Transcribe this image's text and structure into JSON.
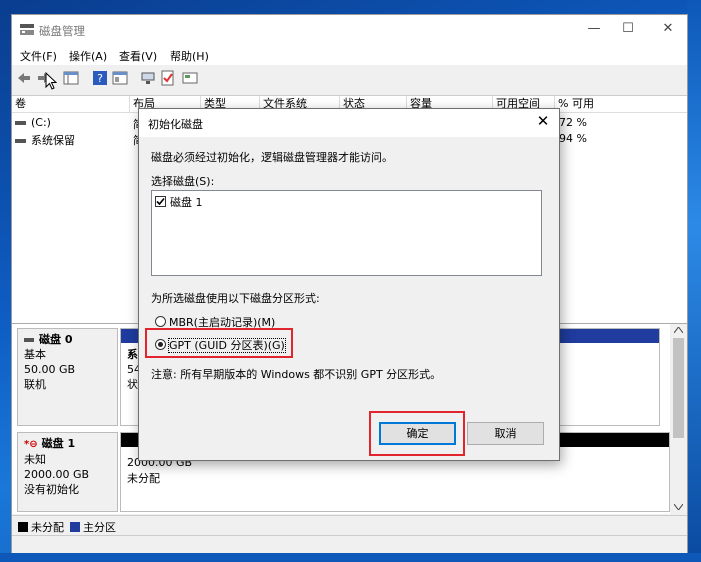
{
  "window": {
    "title": "磁盘管理",
    "controls": {
      "minimize": "—",
      "maximize": "☐",
      "close": "✕"
    }
  },
  "menubar": {
    "items": [
      "文件(F)",
      "操作(A)",
      "查看(V)",
      "帮助(H)"
    ]
  },
  "toolbar": {
    "icons": [
      "back-arrow-icon",
      "forward-arrow-icon",
      "list-view-icon",
      "help-icon",
      "properties-icon",
      "connect-icon",
      "check-icon",
      "settings-icon"
    ]
  },
  "volume_list": {
    "columns": [
      "卷",
      "布局",
      "类型",
      "文件系统",
      "状态",
      "容量",
      "可用空间",
      "% 可用"
    ],
    "rows": [
      {
        "name": "(C:)",
        "layout": "简",
        "pct": "72 %"
      },
      {
        "name": "系统保留",
        "layout": "简",
        "pct": "94 %"
      }
    ]
  },
  "disks": [
    {
      "name": "磁盘 0",
      "type": "基本",
      "size": "50.00 GB",
      "status": "联机",
      "partition_line1": "系",
      "partition_line2": "54",
      "partition_line3": "状"
    },
    {
      "name": "磁盘 1",
      "type": "未知",
      "size": "2000.00 GB",
      "status": "没有初始化",
      "partition_size": "2000.00 GB",
      "partition_status": "未分配"
    }
  ],
  "legend": {
    "unallocated": "未分配",
    "primary": "主分区",
    "colors": {
      "unallocated": "#000000",
      "primary": "#1f3c9e"
    }
  },
  "dialog": {
    "title": "初始化磁盘",
    "intro": "磁盘必须经过初始化，逻辑磁盘管理器才能访问。",
    "select_label": "选择磁盘(S):",
    "disk_item": "磁盘 1",
    "style_label": "为所选磁盘使用以下磁盘分区形式:",
    "mbr_option": "MBR(主启动记录)(M)",
    "gpt_option": "GPT (GUID 分区表)(G)",
    "note": "注意: 所有早期版本的 Windows 都不识别 GPT 分区形式。",
    "ok_label": "确定",
    "cancel_label": "取消",
    "close": "✕"
  },
  "colors": {
    "accent": "#0078d7",
    "highlight": "#e0262c"
  }
}
